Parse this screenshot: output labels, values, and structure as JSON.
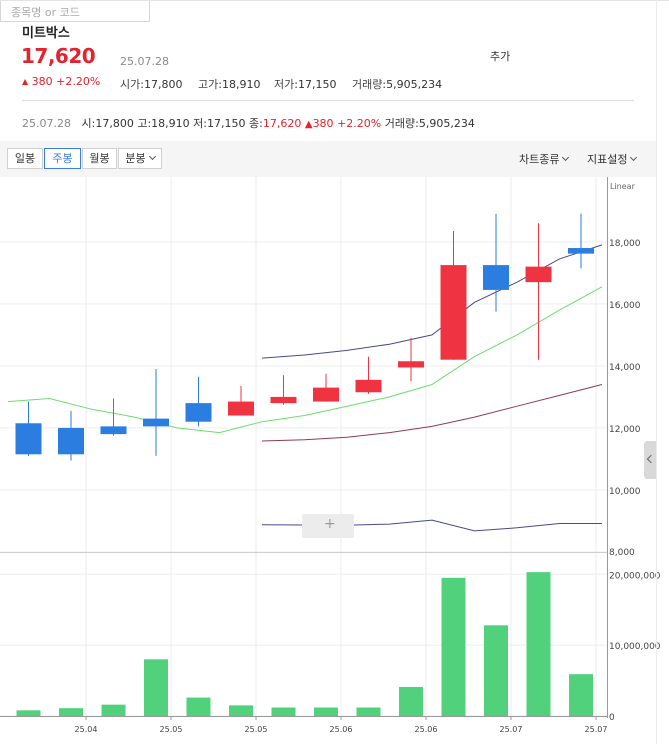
{
  "header": {
    "stock_name": "미트박스",
    "price": "17,620",
    "date": "25.07.28",
    "change_arrow": "▲",
    "change_amount": "380",
    "change_pct": "+2.20%",
    "open_label": "시가",
    "open_value": "17,800",
    "high_label": "고가",
    "high_value": "18,910",
    "low_label": "저가",
    "low_value": "17,150",
    "volume_label": "거래량",
    "volume_value": "5,905,234"
  },
  "search": {
    "placeholder": "종목명 or 코드",
    "add_label": "추가"
  },
  "info_row": {
    "date": "25.07.28",
    "open_label": "시",
    "open_value": "17,800",
    "high_label": "고",
    "high_value": "18,910",
    "low_label": "저",
    "low_value": "17,150",
    "close_label": "종",
    "close_value": "17,620",
    "change_arrow": "▲",
    "change_amount": "380",
    "change_pct": "+2.20%",
    "volume_label": "거래량",
    "volume_value": "5,905,234"
  },
  "toolbar": {
    "daily": "일봉",
    "weekly": "주봉",
    "monthly": "월봉",
    "minute": "분봉",
    "chart_type": "차트종류",
    "indicator_settings": "지표설정",
    "active": "주봉"
  },
  "colors": {
    "up": "#ef3340",
    "down": "#2b7de0",
    "volume": "#52d17d",
    "ma_short": "#474a8e",
    "ma_mid": "#6fdb6f",
    "ma_long": "#8e3b50",
    "sub_line": "#474a8e",
    "price_red": "#e3232e"
  },
  "chart_data": {
    "type": "candlestick",
    "scale_label": "Linear",
    "price_ylim": [
      8000,
      19800
    ],
    "price_ticks": [
      8000,
      10000,
      12000,
      14000,
      16000,
      18000
    ],
    "price_tick_labels": [
      "8,000",
      "10,000",
      "12,000",
      "14,000",
      "16,000",
      "18,000"
    ],
    "volume_ylim": [
      0,
      23000000
    ],
    "volume_ticks": [
      0,
      10000000,
      20000000
    ],
    "volume_tick_labels": [
      "0",
      "10,000,000",
      "20,000,000"
    ],
    "x_tick_labels": [
      {
        "index": 0,
        "label": "25.04"
      },
      {
        "index": 2,
        "label": "25.05"
      },
      {
        "index": 4,
        "label": "25.05"
      },
      {
        "index": 6,
        "label": "25.06"
      },
      {
        "index": 8,
        "label": "25.06"
      },
      {
        "index": 10,
        "label": "25.07"
      },
      {
        "index": 12,
        "label": "25.07"
      }
    ],
    "candles": [
      {
        "open": 12150,
        "high": 12850,
        "low": 11100,
        "close": 11150
      },
      {
        "open": 12000,
        "high": 12550,
        "low": 10950,
        "close": 11150
      },
      {
        "open": 12050,
        "high": 12950,
        "low": 11750,
        "close": 11800
      },
      {
        "open": 12300,
        "high": 13900,
        "low": 11100,
        "close": 12050
      },
      {
        "open": 12800,
        "high": 13650,
        "low": 12050,
        "close": 12200
      },
      {
        "open": 12400,
        "high": 13350,
        "low": 12400,
        "close": 12850
      },
      {
        "open": 12800,
        "high": 13700,
        "low": 12750,
        "close": 13000
      },
      {
        "open": 12850,
        "high": 13750,
        "low": 12850,
        "close": 13300
      },
      {
        "open": 13150,
        "high": 14300,
        "low": 13100,
        "close": 13550
      },
      {
        "open": 13950,
        "high": 14900,
        "low": 13500,
        "close": 14150
      },
      {
        "open": 14200,
        "high": 18350,
        "low": 14200,
        "close": 17250
      },
      {
        "open": 17250,
        "high": 18900,
        "low": 15750,
        "close": 16450
      },
      {
        "open": 16700,
        "high": 18600,
        "low": 14200,
        "close": 17200
      },
      {
        "open": 17800,
        "high": 18910,
        "low": 17150,
        "close": 17620
      }
    ],
    "volume": [
      800000,
      1100000,
      1600000,
      8000000,
      2600000,
      1500000,
      1200000,
      1200000,
      1200000,
      4100000,
      19500000,
      12800000,
      20300000,
      5900000
    ],
    "ma_short": [
      null,
      null,
      null,
      null,
      null,
      null,
      14250,
      14350,
      14500,
      14700,
      15000,
      16050,
      16700,
      17450,
      17900
    ],
    "ma_mid": [
      12850,
      12950,
      12600,
      12350,
      12000,
      11850,
      12200,
      12400,
      12700,
      13000,
      13400,
      14300,
      15000,
      15800,
      16550
    ],
    "ma_long": [
      null,
      null,
      null,
      null,
      null,
      null,
      11580,
      11620,
      11700,
      11850,
      12050,
      12350,
      12700,
      13050,
      13400
    ],
    "sub_line": [
      null,
      null,
      null,
      null,
      null,
      null,
      8880,
      8870,
      8860,
      8900,
      9030,
      8680,
      8780,
      8920,
      8920
    ]
  }
}
